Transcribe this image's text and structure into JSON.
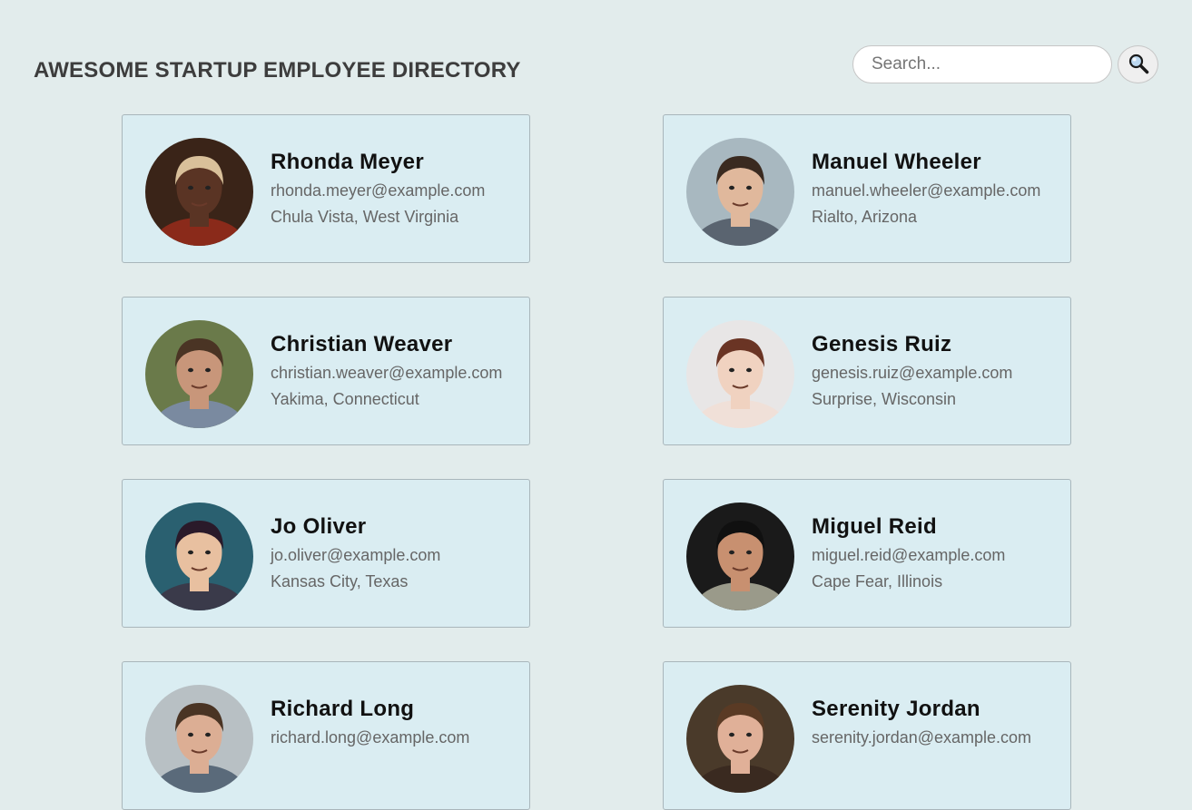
{
  "header": {
    "title": "AWESOME STARTUP EMPLOYEE DIRECTORY",
    "search_placeholder": "Search...",
    "search_button_icon": "search-icon"
  },
  "employees": [
    {
      "name": "Rhonda Meyer",
      "email": "rhonda.meyer@example.com",
      "location": "Chula Vista, West Virginia",
      "avatar": {
        "bg": "#3a2418",
        "skin": "#5a3424",
        "hair": "#d9c09a",
        "shirt": "#8a2a1a"
      }
    },
    {
      "name": "Manuel Wheeler",
      "email": "manuel.wheeler@example.com",
      "location": "Rialto, Arizona",
      "avatar": {
        "bg": "#a8b8c0",
        "skin": "#e0b89c",
        "hair": "#3a2a20",
        "shirt": "#5a6470"
      }
    },
    {
      "name": "Christian Weaver",
      "email": "christian.weaver@example.com",
      "location": "Yakima, Connecticut",
      "avatar": {
        "bg": "#6a7a4a",
        "skin": "#c8967a",
        "hair": "#4a3424",
        "shirt": "#7a8aa0"
      }
    },
    {
      "name": "Genesis Ruiz",
      "email": "genesis.ruiz@example.com",
      "location": "Surprise, Wisconsin",
      "avatar": {
        "bg": "#e8e6e6",
        "skin": "#f0d2c0",
        "hair": "#6a3424",
        "shirt": "#f0e0d8"
      }
    },
    {
      "name": "Jo Oliver",
      "email": "jo.oliver@example.com",
      "location": "Kansas City, Texas",
      "avatar": {
        "bg": "#2a6070",
        "skin": "#e8c0a0",
        "hair": "#2a1a2a",
        "shirt": "#3a3a4a"
      }
    },
    {
      "name": "Miguel Reid",
      "email": "miguel.reid@example.com",
      "location": "Cape Fear, Illinois",
      "avatar": {
        "bg": "#1a1a1a",
        "skin": "#c89070",
        "hair": "#101010",
        "shirt": "#9a9a8a"
      }
    },
    {
      "name": "Richard Long",
      "email": "richard.long@example.com",
      "location": "",
      "avatar": {
        "bg": "#b8c0c4",
        "skin": "#dcae94",
        "hair": "#4a3424",
        "shirt": "#5a6a7a"
      }
    },
    {
      "name": "Serenity Jordan",
      "email": "serenity.jordan@example.com",
      "location": "",
      "avatar": {
        "bg": "#4a3a2a",
        "skin": "#e0b098",
        "hair": "#5a3a24",
        "shirt": "#3a2a20"
      }
    }
  ]
}
